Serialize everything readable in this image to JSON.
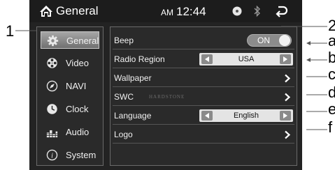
{
  "statusbar": {
    "title": "General",
    "ampm": "AM",
    "time": "12:44"
  },
  "sidebar": {
    "items": [
      {
        "label": "General",
        "icon": "gear-icon",
        "active": true
      },
      {
        "label": "Video",
        "icon": "film-reel-icon",
        "active": false
      },
      {
        "label": "NAVI",
        "icon": "compass-icon",
        "active": false
      },
      {
        "label": "Clock",
        "icon": "clock-icon",
        "active": false
      },
      {
        "label": "Audio",
        "icon": "equalizer-icon",
        "active": false
      },
      {
        "label": "System",
        "icon": "info-icon",
        "active": false
      }
    ]
  },
  "settings": {
    "beep": {
      "label": "Beep",
      "value": "ON"
    },
    "radio_region": {
      "label": "Radio Region",
      "value": "USA"
    },
    "wallpaper": {
      "label": "Wallpaper"
    },
    "swc": {
      "label": "SWC",
      "brand": "HARDSTONE"
    },
    "language": {
      "label": "Language",
      "value": "English"
    },
    "logo": {
      "label": "Logo"
    }
  },
  "callouts": {
    "one": "1",
    "two": "2",
    "a": "a",
    "b": "b",
    "c": "c",
    "d": "d",
    "e": "e",
    "f": "f"
  },
  "colors": {
    "screen_bg": "#232323",
    "toggle_on": "#8c8c8c",
    "selector_bg": "#e4e4e4"
  }
}
